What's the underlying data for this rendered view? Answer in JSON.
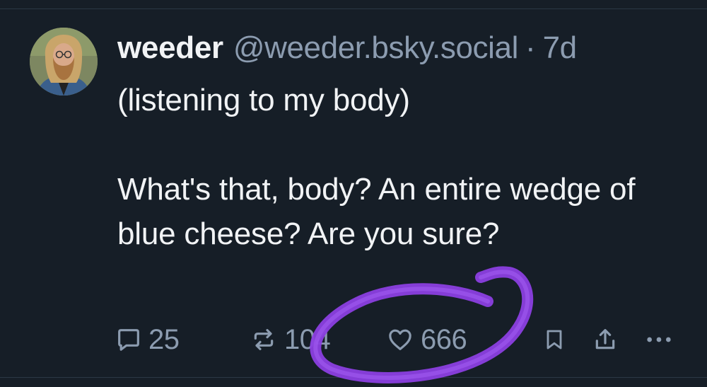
{
  "post": {
    "author": {
      "display_name": "weeder",
      "handle": "@weeder.bsky.social",
      "separator": "·",
      "time": "7d",
      "avatar_icon": "bearded-man-avatar"
    },
    "text": "(listening to my body)\n\nWhat's that, body? An entire wedge of blue cheese? Are you sure?",
    "actions": {
      "reply": {
        "icon": "speech-bubble-icon",
        "count": "25"
      },
      "repost": {
        "icon": "repost-arrows-icon",
        "count": "104"
      },
      "like": {
        "icon": "heart-icon",
        "count": "666"
      },
      "bookmark": {
        "icon": "bookmark-icon"
      },
      "share": {
        "icon": "share-icon"
      },
      "more": {
        "icon": "ellipsis-icon"
      }
    }
  },
  "colors": {
    "background": "#161e27",
    "text_primary": "#f1f3f5",
    "text_secondary": "#8c9cb0",
    "scribble": "#8b3fe0"
  }
}
